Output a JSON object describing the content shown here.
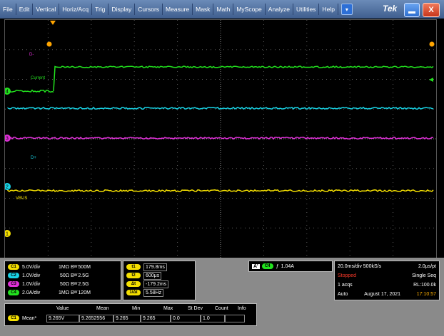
{
  "menu": [
    "File",
    "Edit",
    "Vertical",
    "Horiz/Acq",
    "Trig",
    "Display",
    "Cursors",
    "Measure",
    "Mask",
    "Math",
    "MyScope",
    "Analyze",
    "Utilities",
    "Help"
  ],
  "brand": "Tek",
  "close_glyph": "X",
  "trace_labels": {
    "d_minus": "D-",
    "current": "Current",
    "d_plus": "D+",
    "vbus": "VBUS"
  },
  "channel_markers": {
    "ch1": "1",
    "ch2": "2",
    "ch3": "3",
    "ch4": "4"
  },
  "colors": {
    "ch1": "#f5e000",
    "ch2": "#19d4e6",
    "ch3": "#e030d8",
    "ch4": "#22e21e",
    "trigger": "#ffa500",
    "grid": "#5a5a5a"
  },
  "channels": [
    {
      "badge": "C1",
      "scale": "5.0V/div",
      "imp": "1MΩ",
      "bw": "500M",
      "color": "#f5e000"
    },
    {
      "badge": "C2",
      "scale": "1.0V/div",
      "imp": "50Ω",
      "bw": "2.5G",
      "color": "#19d4e6"
    },
    {
      "badge": "C3",
      "scale": "1.0V/div",
      "imp": "50Ω",
      "bw": "2.5G",
      "color": "#e030d8"
    },
    {
      "badge": "C4",
      "scale": "2.0A/div",
      "imp": "1MΩ",
      "bw": "120M",
      "color": "#22e21e"
    }
  ],
  "bw_prefix": "B",
  "bw_sub": "W",
  "cursors": [
    {
      "badge": "t1",
      "value": "179.8ms"
    },
    {
      "badge": "t2",
      "value": "600μs"
    },
    {
      "badge": "Δt",
      "value": "-179.2ms"
    },
    {
      "badge": "1/Δt",
      "value": "5.58Hz"
    }
  ],
  "trigger": {
    "mode": "A'",
    "channel": "C4",
    "slope": "ƒ",
    "level": "1.04A"
  },
  "acq": {
    "timebase": "20.0ms/div 500kS/s",
    "pt": "2.0μs/pt",
    "state": "Stopped",
    "seq": "Single Seq",
    "acqs": "1 acqs",
    "rl": "RL:100.0k",
    "auto": "Auto",
    "date": "August 17, 2021",
    "time": "17:10:57"
  },
  "measure": {
    "headers": {
      "value": "Value",
      "mean": "Mean",
      "min": "Min",
      "max": "Max",
      "stdev": "St Dev",
      "count": "Count",
      "info": "Info"
    },
    "row": {
      "badge": "C1",
      "name": "Mean*",
      "value": "9.265V",
      "mean": "9.2652556",
      "min": "9.265",
      "max": "9.265",
      "stdev": "0.0",
      "count": "1.0",
      "info": ""
    }
  }
}
